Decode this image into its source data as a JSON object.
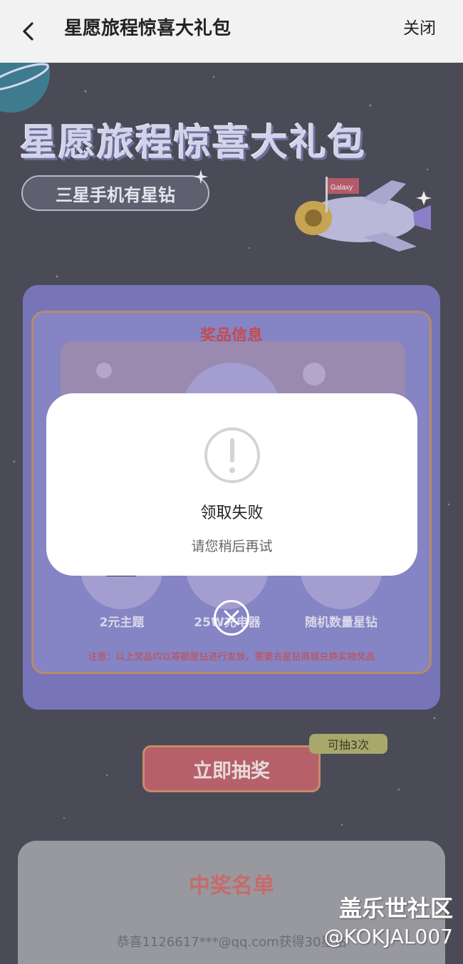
{
  "appbar": {
    "title": "星愿旅程惊喜大礼包",
    "close_label": "关闭"
  },
  "hero": {
    "title": "星愿旅程惊喜大礼包",
    "subtitle": "三星手机有星钻",
    "flag_text": "Galaxy"
  },
  "prize_card": {
    "header": "奖品信息",
    "items": [
      {
        "label": "2元主题"
      },
      {
        "label": "25W充电器"
      },
      {
        "label": "随机数量星钻"
      }
    ],
    "note": "注意：以上奖品均以等额星钻进行发放，需要去星钻商城兑换实物奖品"
  },
  "draw": {
    "button_label": "立即抽奖",
    "remaining_badge": "可抽3次"
  },
  "winners": {
    "title": "中奖名单",
    "row": "恭喜1126617***@qq.com获得30星钻"
  },
  "dialog": {
    "title": "领取失败",
    "message": "请您稍后再试"
  },
  "watermark": {
    "line1": "盖乐世社区",
    "line2": "@KOKJAL007"
  }
}
